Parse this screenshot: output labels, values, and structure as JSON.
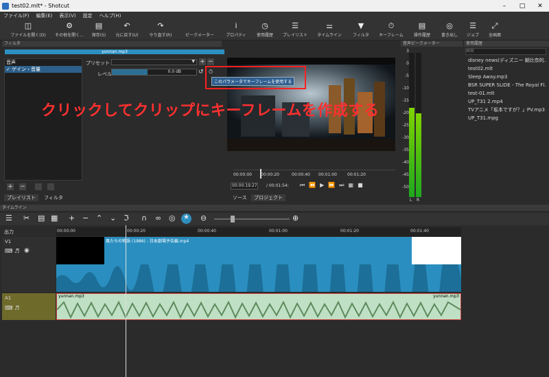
{
  "window": {
    "title": "test02.mlt* - Shotcut"
  },
  "menu": [
    "ファイル(F)",
    "編集(E)",
    "表示(V)",
    "設定",
    "ヘルプ(H)"
  ],
  "toolbar": [
    {
      "label": "ファイルを開く(O)",
      "icon": "open-file-icon"
    },
    {
      "label": "その他を開く...",
      "icon": "open-other-icon"
    },
    {
      "label": "保存(S)",
      "icon": "save-icon"
    },
    {
      "label": "元に戻す(U)",
      "icon": "undo-icon"
    },
    {
      "label": "やり直す(R)",
      "icon": "redo-icon"
    },
    {
      "label": "ピークメーター",
      "icon": "peak-meter-icon"
    },
    {
      "label": "プロパティ",
      "icon": "properties-icon"
    },
    {
      "label": "使用履歴",
      "icon": "recent-icon"
    },
    {
      "label": "プレイリスト",
      "icon": "playlist-icon"
    },
    {
      "label": "タイムライン",
      "icon": "timeline-icon"
    },
    {
      "label": "フィルタ",
      "icon": "filter-icon"
    },
    {
      "label": "キーフレーム",
      "icon": "keyframe-icon"
    },
    {
      "label": "操作履歴",
      "icon": "history-icon"
    },
    {
      "label": "書き出し",
      "icon": "export-icon"
    },
    {
      "label": "ジョブ",
      "icon": "jobs-icon"
    },
    {
      "label": "全画面",
      "icon": "fullscreen-icon"
    }
  ],
  "filter_panel": {
    "title": "フィルタ",
    "clip_name": "yunnan.mp3",
    "category": "音声",
    "selected_filter": "ゲイン・音量",
    "preset_label": "プリセット",
    "level_label": "レベル",
    "level_value": "0.0 dB",
    "level_fraction": 0.42,
    "tabs": [
      "プレイリスト",
      "フィルタ"
    ]
  },
  "tooltip": "このパラメータでキーフレームを使用する",
  "overlay_caption": "クリックしてクリップにキーフレームを作成する",
  "player": {
    "current_time": "00:00:19:27",
    "total_time": "/ 00:01:54:",
    "ruler_ticks": [
      "00:00:00",
      "00:00:20",
      "00:00:40",
      "00:01:00",
      "00:01:20"
    ],
    "tabs": [
      "ソース",
      "プロジェクト"
    ]
  },
  "meter": {
    "title": "音声ピークメーター",
    "scale": [
      "3",
      "0",
      "-5",
      "-10",
      "-15",
      "-20",
      "-25",
      "-30",
      "-35",
      "-40",
      "-45",
      "-50"
    ],
    "channels": [
      "L",
      "R"
    ],
    "left_level": 0.62,
    "right_level": 0.58
  },
  "recent": {
    "title": "使用履歴",
    "search_placeholder": "検索",
    "items": [
      "disney news(ディズニー 朝比奈的...",
      "test02.mlt",
      "Sleep Away.mp3",
      "BSR SUPER SLIDE - The Royal Fl...",
      "test-01.mlt",
      "UP_T31 2.mp4",
      "TVアニメ「坂本ですが？」PV.mp3",
      "UP_T31.mpg"
    ]
  },
  "timeline": {
    "title": "タイムライン",
    "output_label": "出力",
    "ruler": [
      "00:00:00",
      "00:00:20",
      "00:00:40",
      "00:01:00",
      "00:01:20",
      "00:01:40"
    ],
    "video_track": "V1",
    "audio_track": "A1",
    "video_clip_label": "風たちの物語 (1986) - 日本劇場予告編.mp4",
    "audio_clip_label": "yunnan.mp3"
  },
  "colors": {
    "accent": "#2d8fc0",
    "audio": "#5e8a5e",
    "highlight": "#ff2020"
  }
}
